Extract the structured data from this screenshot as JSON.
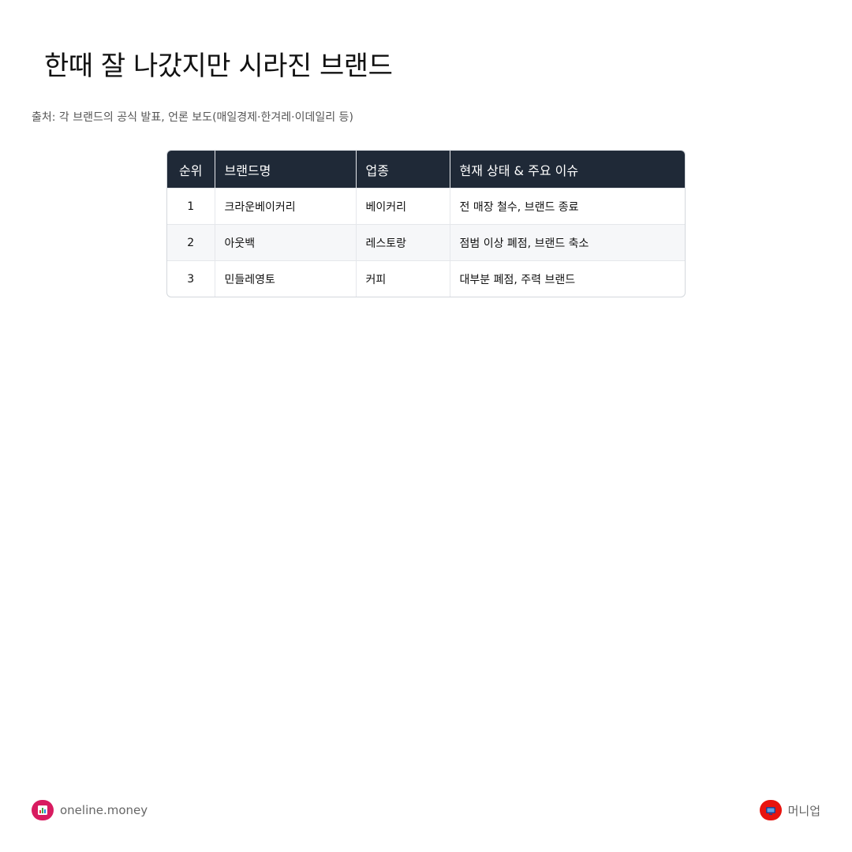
{
  "title": "한때 잘 나갔지만 시라진 브랜드",
  "source": "출처: 각 브랜드의 공식 발표, 언론 보도(매일경제·한겨레·이데일리 등)",
  "table": {
    "headers": [
      "순위",
      "브랜드명",
      "업종",
      "현재 상태 & 주요 이슈"
    ],
    "rows": [
      [
        "1",
        "크라운베이커리",
        "베이커리",
        "전 매장 철수, 브랜드 종료"
      ],
      [
        "2",
        "아웃백",
        "레스토랑",
        "점범 이상 폐점, 브랜드 축소"
      ],
      [
        "3",
        "민들레영토",
        "커피",
        "대부분 폐점, 주력 브랜드"
      ]
    ]
  },
  "footer": {
    "left_icon": "bar-chart-icon",
    "left_text": "oneline.money",
    "right_icon": "tv-icon",
    "right_text": "머니업"
  }
}
